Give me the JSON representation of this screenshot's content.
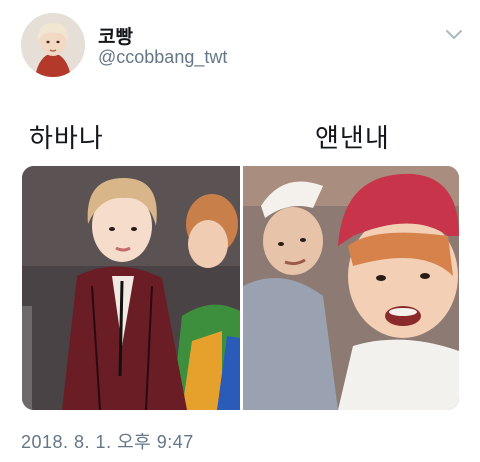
{
  "tweet": {
    "display_name": "코빵",
    "handle": "@ccobbang_twt",
    "menu_icon": "chevron-down-icon",
    "caption_left": "하바나",
    "caption_right": "얜낸내",
    "timestamp": "2018. 8. 1. 오후 9:47"
  },
  "colors": {
    "text_primary": "#14171a",
    "text_secondary": "#657786",
    "background": "#ffffff"
  }
}
